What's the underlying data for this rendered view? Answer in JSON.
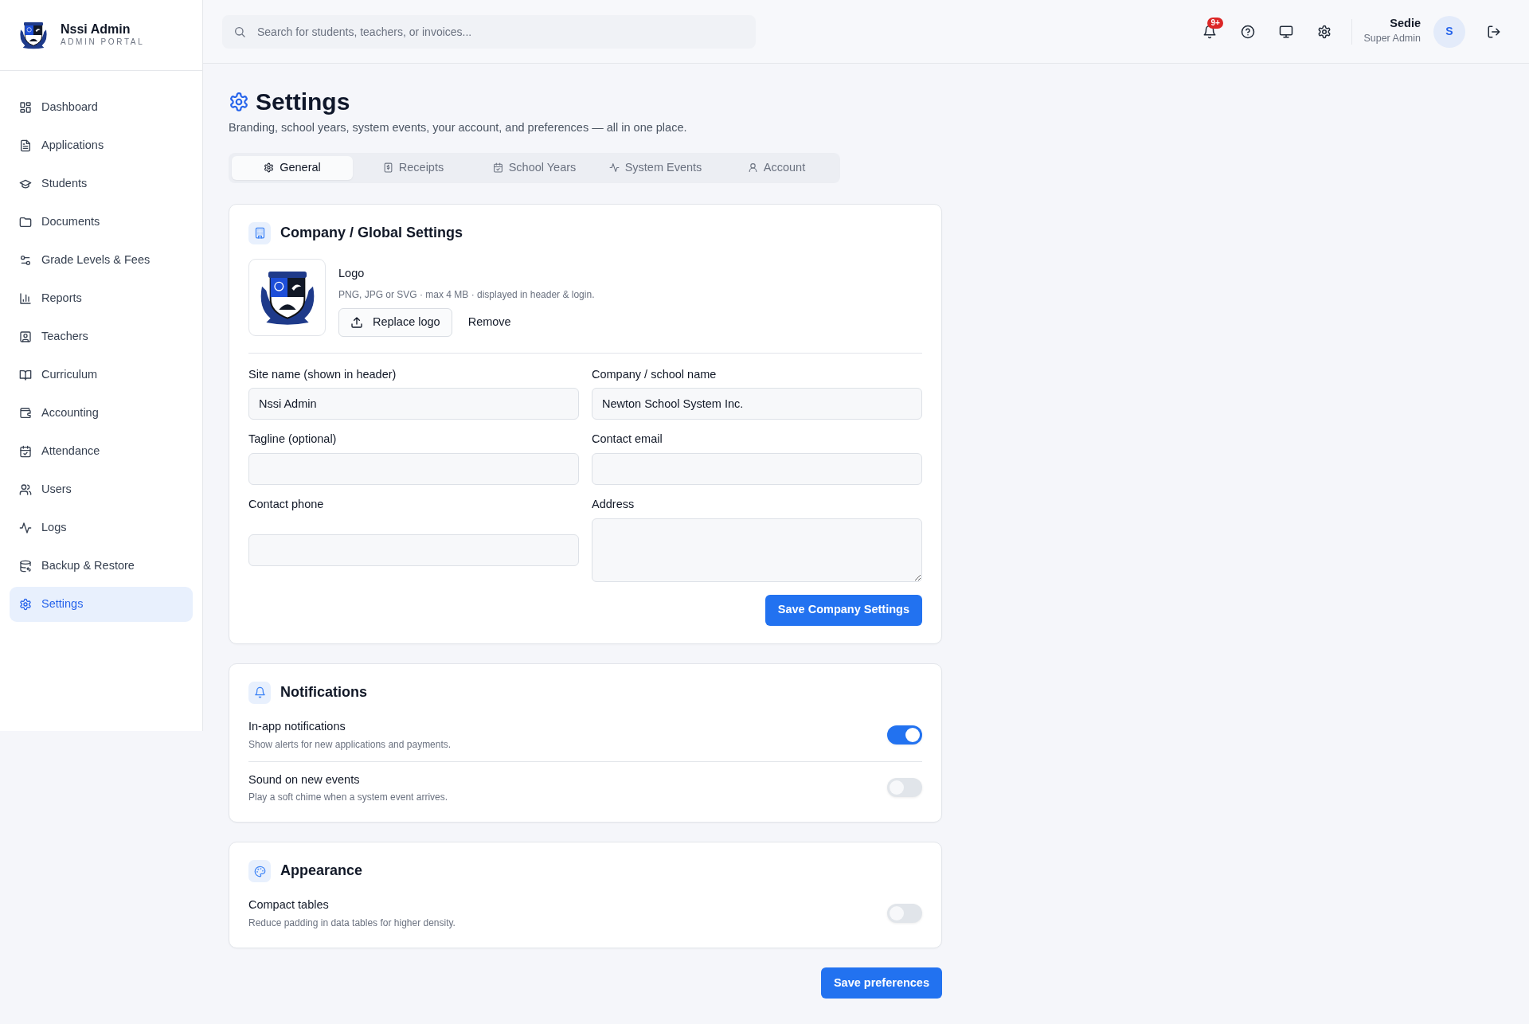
{
  "brand": {
    "name": "Nssi Admin",
    "subtitle": "ADMIN PORTAL"
  },
  "sidebar": {
    "items": [
      {
        "label": "Dashboard",
        "selected": false
      },
      {
        "label": "Applications",
        "selected": false
      },
      {
        "label": "Students",
        "selected": false
      },
      {
        "label": "Documents",
        "selected": false
      },
      {
        "label": "Grade Levels & Fees",
        "selected": false
      },
      {
        "label": "Reports",
        "selected": false
      },
      {
        "label": "Teachers",
        "selected": false
      },
      {
        "label": "Curriculum",
        "selected": false
      },
      {
        "label": "Accounting",
        "selected": false
      },
      {
        "label": "Attendance",
        "selected": false
      },
      {
        "label": "Users",
        "selected": false
      },
      {
        "label": "Logs",
        "selected": false
      },
      {
        "label": "Backup & Restore",
        "selected": false
      },
      {
        "label": "Settings",
        "selected": true
      }
    ]
  },
  "search": {
    "placeholder": "Search for students, teachers, or invoices..."
  },
  "topbar": {
    "notification_badge": "9+",
    "user": {
      "name": "Sedie",
      "role": "Super Admin",
      "initial": "S"
    }
  },
  "page": {
    "title": "Settings",
    "subtitle": "Branding, school years, system events, your account, and preferences — all in one place."
  },
  "tabs": [
    {
      "label": "General",
      "selected": true
    },
    {
      "label": "Receipts",
      "selected": false
    },
    {
      "label": "School Years",
      "selected": false
    },
    {
      "label": "System Events",
      "selected": false
    },
    {
      "label": "Account",
      "selected": false
    }
  ],
  "company_card": {
    "title": "Company / Global Settings",
    "logo": {
      "label": "Logo",
      "hint": "PNG, JPG or SVG · max 4 MB · displayed in header & login.",
      "replace_button": "Replace logo",
      "remove_button": "Remove"
    },
    "fields": [
      {
        "label": "Site name (shown in header)",
        "value": "Nssi Admin",
        "kind": "input"
      },
      {
        "label": "Company / school name",
        "value": "Newton School System Inc.",
        "kind": "input"
      },
      {
        "label": "Tagline (optional)",
        "kind": "input"
      },
      {
        "label": "Contact email",
        "kind": "input"
      },
      {
        "label": "Contact phone",
        "kind": "input"
      },
      {
        "label": "Address",
        "kind": "textarea"
      }
    ],
    "save_button": "Save Company Settings"
  },
  "notifications": {
    "title": "Notifications",
    "items": [
      {
        "label": "In-app notifications",
        "description": "Show alerts for new applications and payments.",
        "on": true
      },
      {
        "label": "Sound on new events",
        "description": "Play a soft chime when a system event arrives.",
        "on": false
      }
    ]
  },
  "appearance": {
    "title": "Appearance",
    "items": [
      {
        "label": "Compact tables",
        "description": "Reduce padding in data tables for higher density.",
        "on": false
      }
    ]
  },
  "save_preferences_button": "Save preferences"
}
